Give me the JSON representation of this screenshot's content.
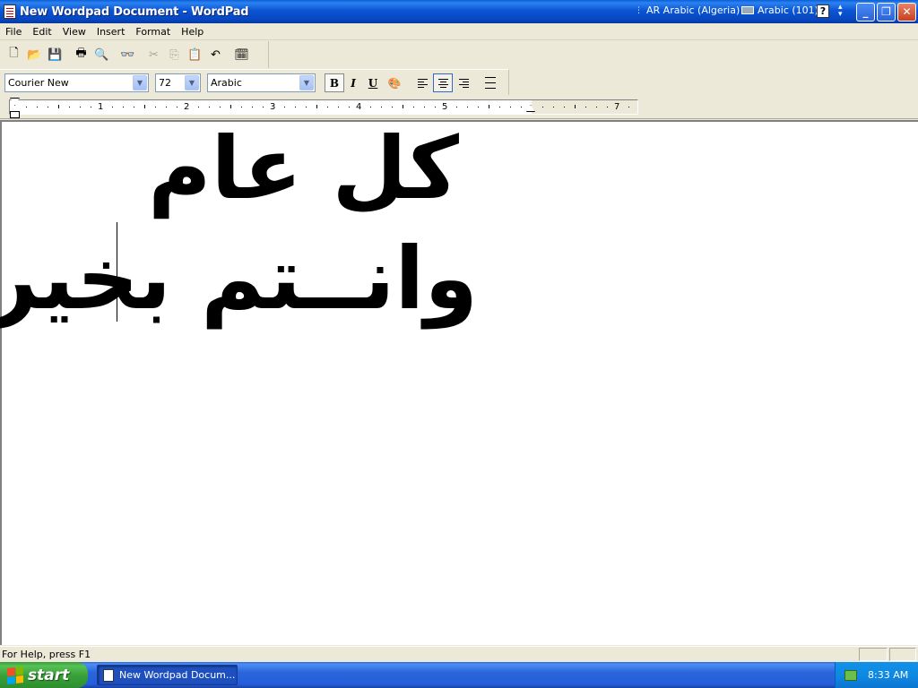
{
  "window": {
    "title": "New Wordpad Document - WordPad",
    "language_indicator": "AR Arabic (Algeria)",
    "keyboard_layout": "Arabic (101)",
    "help_glyph": "?",
    "minimize_glyph": "_",
    "maximize_glyph": "❐",
    "close_glyph": "✕"
  },
  "menu": {
    "file": "File",
    "edit": "Edit",
    "view": "View",
    "insert": "Insert",
    "format": "Format",
    "help": "Help"
  },
  "toolbar": {
    "icons": [
      "new-icon",
      "open-icon",
      "save-icon",
      "print-icon",
      "print-preview-icon",
      "find-icon",
      "cut-icon",
      "copy-icon",
      "paste-icon",
      "undo-icon",
      "date-time-icon"
    ]
  },
  "format_bar": {
    "font": "Courier New",
    "size": "72",
    "script": "Arabic",
    "bold": "B",
    "italic": "I",
    "underline": "U"
  },
  "ruler": {
    "labels": [
      "1",
      "2",
      "3",
      "4",
      "5",
      "7"
    ]
  },
  "document": {
    "line1": "كل عام",
    "line2": "وانــتم بخير"
  },
  "status": {
    "help_text": "For Help, press F1"
  },
  "taskbar": {
    "start_label": "start",
    "task_item": "New Wordpad Docum...",
    "clock": "8:33 AM"
  },
  "colors": {
    "titlebar": "#0b55d4",
    "taskbar": "#245edb",
    "start_button": "#3aa23a",
    "close_button": "#c7401f",
    "chrome": "#ece9d8"
  }
}
